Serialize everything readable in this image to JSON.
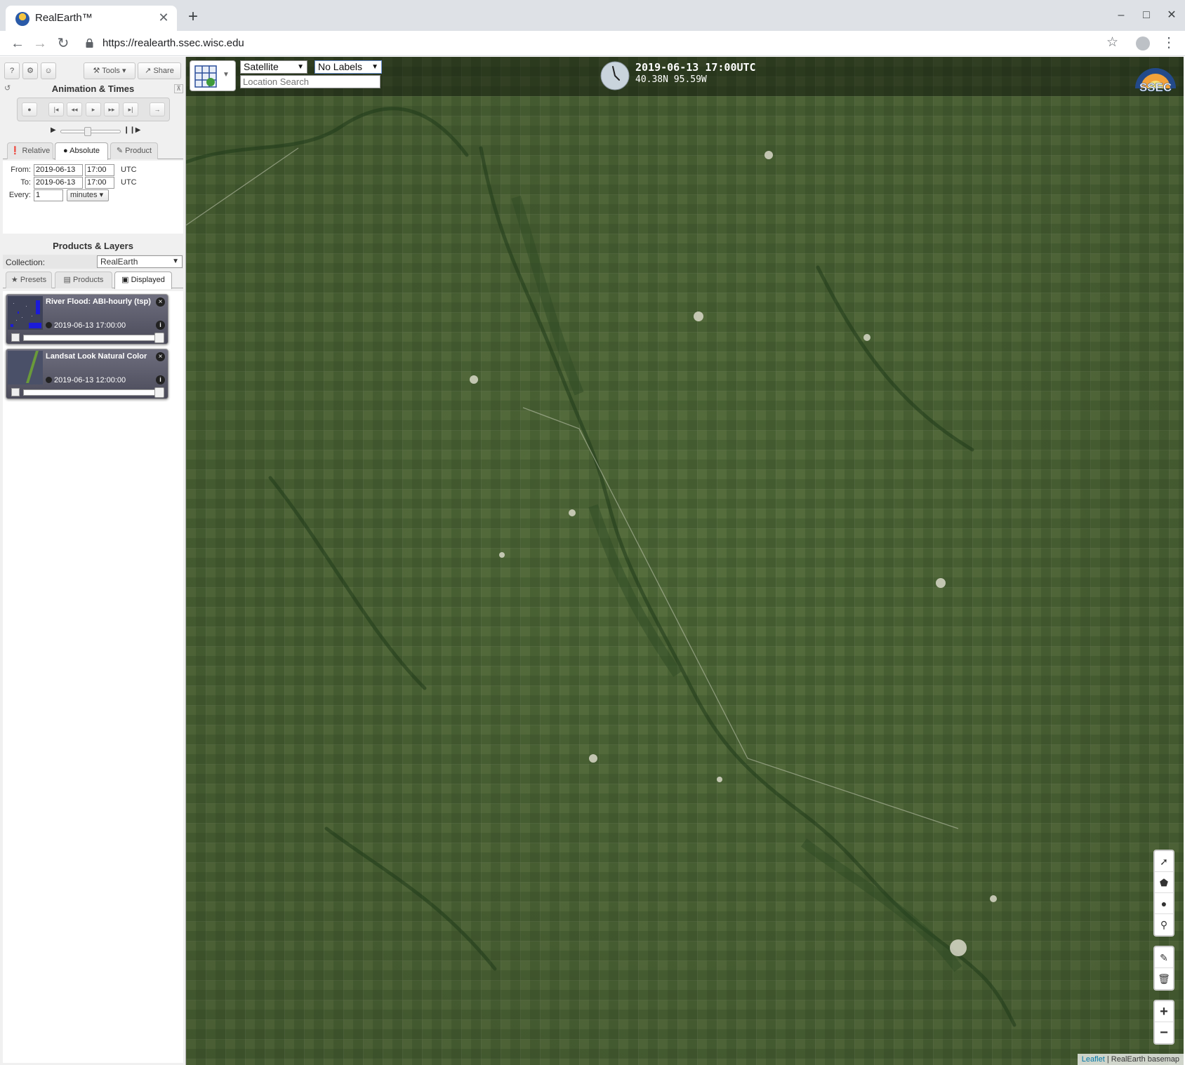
{
  "browser": {
    "tab_title": "RealEarth™",
    "tab_close": "✕",
    "new_tab": "+",
    "url": "https://realearth.ssec.wisc.edu",
    "window_minimize": "–",
    "window_maximize": "□",
    "window_close": "✕"
  },
  "panel": {
    "top_buttons": {
      "help": "?",
      "settings": "⚙",
      "user": "☺",
      "tools": "Tools",
      "share": "Share"
    },
    "animation": {
      "title": "Animation & Times",
      "controls": [
        "●",
        "|◂",
        "◂◂",
        "▸",
        "▸▸",
        "▸|",
        "→"
      ],
      "speed_level": 0.45
    },
    "time_tabs": [
      "Relative",
      "Absolute",
      "Product"
    ],
    "active_time_tab": "Absolute",
    "times": {
      "from_label": "From:",
      "from_date": "2019-06-13",
      "from_time": "17:00",
      "to_label": "To:",
      "to_date": "2019-06-13",
      "to_time": "17:00",
      "tz": "UTC",
      "every_label": "Every:",
      "every_value": "1",
      "every_unit": "minutes ▾"
    },
    "products": {
      "title": "Products & Layers",
      "collection_label": "Collection:",
      "collection_value": "RealEarth",
      "tabs": [
        "Presets",
        "Products",
        "Displayed"
      ],
      "active_tab": "Displayed",
      "layers": [
        {
          "name": "River Flood: ABI-hourly (tsp)",
          "time": "2019-06-13 17:00:00",
          "opacity": 1.0
        },
        {
          "name": "Landsat Look Natural Color",
          "time": "2019-06-13 12:00:00",
          "opacity": 1.0
        }
      ]
    }
  },
  "map": {
    "basemap_select": "Satellite",
    "labels_select": "No Labels",
    "search_placeholder": "Location Search",
    "time": "2019-06-13 17:00UTC",
    "coords": "40.38N 95.59W",
    "logo_text": "SSEC",
    "draw_tools": [
      "polyline-icon",
      "polygon-icon",
      "circle-icon",
      "marker-icon"
    ],
    "edit_tools": [
      "edit-icon",
      "trash-icon"
    ],
    "zoom_in": "+",
    "zoom_out": "−",
    "attribution_link": "Leaflet",
    "attribution_text": " | RealEarth basemap"
  }
}
